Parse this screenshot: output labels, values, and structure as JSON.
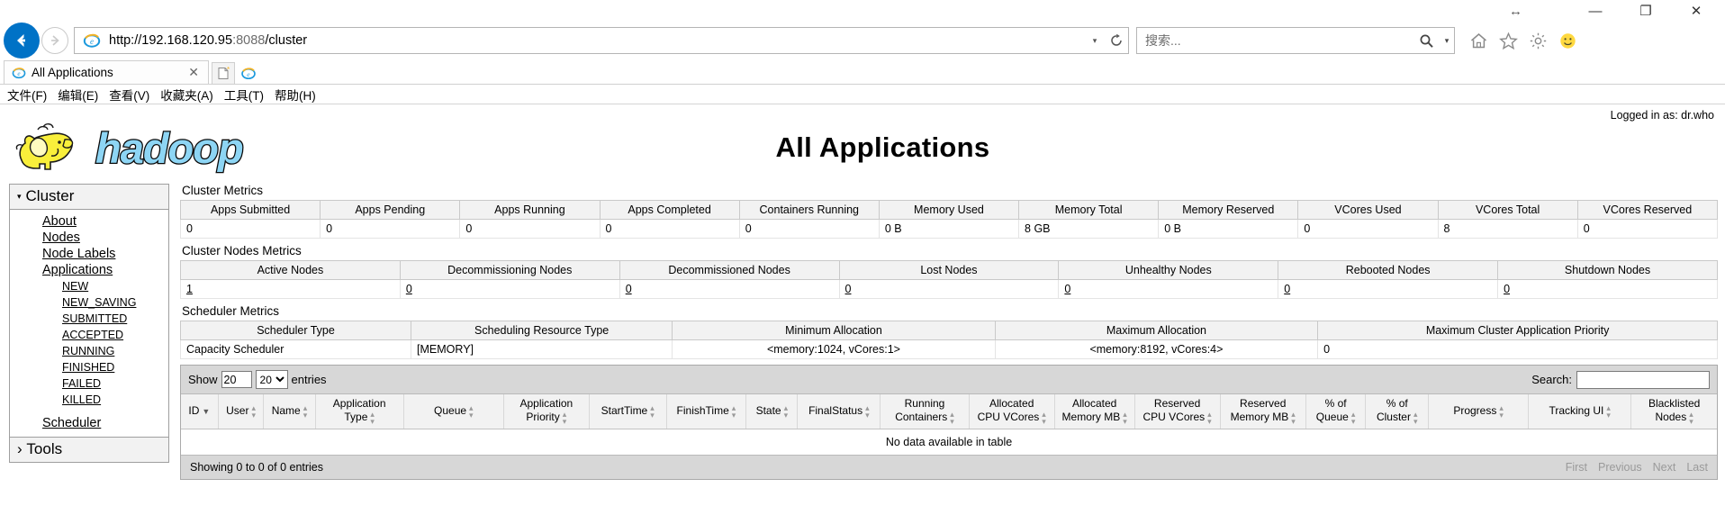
{
  "browser": {
    "window_controls": {
      "minimize": "—",
      "restore": "❐",
      "close": "✕",
      "restore_hint": "↔"
    },
    "nav": {
      "back": "back-arrow",
      "forward": "forward-arrow"
    },
    "address": {
      "url_scheme": "http://192.168.120.95",
      "url_port": ":8088",
      "url_path": "/cluster",
      "dropdown": "▾",
      "refresh": "refresh-icon"
    },
    "search": {
      "placeholder": "搜索...",
      "caret": "▾"
    },
    "toolbar_icons": [
      "home-icon",
      "favorites-star-icon",
      "tools-gear-icon",
      "smiley-feedback-icon"
    ],
    "tab": {
      "label": "All Applications",
      "close": "✕"
    },
    "menubar": [
      "文件(F)",
      "编辑(E)",
      "查看(V)",
      "收藏夹(A)",
      "工具(T)",
      "帮助(H)"
    ]
  },
  "page": {
    "title": "All Applications",
    "logged_in": "Logged in as: dr.who",
    "logo_alt": "hadoop"
  },
  "sidebar": {
    "cluster_header": "Cluster",
    "cluster_caret": "▾",
    "items": [
      {
        "label": "About",
        "sub": false
      },
      {
        "label": "Nodes",
        "sub": false
      },
      {
        "label": "Node Labels",
        "sub": false
      },
      {
        "label": "Applications",
        "sub": false
      },
      {
        "label": "NEW",
        "sub": true
      },
      {
        "label": "NEW_SAVING",
        "sub": true
      },
      {
        "label": "SUBMITTED",
        "sub": true
      },
      {
        "label": "ACCEPTED",
        "sub": true
      },
      {
        "label": "RUNNING",
        "sub": true
      },
      {
        "label": "FINISHED",
        "sub": true
      },
      {
        "label": "FAILED",
        "sub": true
      },
      {
        "label": "KILLED",
        "sub": true
      },
      {
        "label": "Scheduler",
        "sub": false
      }
    ],
    "tools_header": "Tools",
    "tools_caret": "›"
  },
  "cluster_metrics": {
    "label": "Cluster Metrics",
    "headers": [
      "Apps Submitted",
      "Apps Pending",
      "Apps Running",
      "Apps Completed",
      "Containers Running",
      "Memory Used",
      "Memory Total",
      "Memory Reserved",
      "VCores Used",
      "VCores Total",
      "VCores Reserved"
    ],
    "values": [
      "0",
      "0",
      "0",
      "0",
      "0",
      "0 B",
      "8 GB",
      "0 B",
      "0",
      "8",
      "0"
    ]
  },
  "cluster_nodes_metrics": {
    "label": "Cluster Nodes Metrics",
    "headers": [
      "Active Nodes",
      "Decommissioning Nodes",
      "Decommissioned Nodes",
      "Lost Nodes",
      "Unhealthy Nodes",
      "Rebooted Nodes",
      "Shutdown Nodes"
    ],
    "values": [
      "1",
      "0",
      "0",
      "0",
      "0",
      "0",
      "0"
    ]
  },
  "scheduler_metrics": {
    "label": "Scheduler Metrics",
    "headers": [
      "Scheduler Type",
      "Scheduling Resource Type",
      "Minimum Allocation",
      "Maximum Allocation",
      "Maximum Cluster Application Priority"
    ],
    "values": [
      "Capacity Scheduler",
      "[MEMORY]",
      "<memory:1024, vCores:1>",
      "<memory:8192, vCores:4>",
      "0"
    ]
  },
  "apps_table": {
    "show_label": "Show",
    "entries_label": "entries",
    "page_length": "20",
    "search_label": "Search:",
    "search_value": "",
    "headers": [
      {
        "line1": "ID",
        "line2": "",
        "sort": "desc"
      },
      {
        "line1": "User",
        "line2": "",
        "sort": "both"
      },
      {
        "line1": "Name",
        "line2": "",
        "sort": "both"
      },
      {
        "line1": "Application",
        "line2": "Type",
        "sort": "both"
      },
      {
        "line1": "Queue",
        "line2": "",
        "sort": "both"
      },
      {
        "line1": "Application",
        "line2": "Priority",
        "sort": "both"
      },
      {
        "line1": "StartTime",
        "line2": "",
        "sort": "both"
      },
      {
        "line1": "FinishTime",
        "line2": "",
        "sort": "both"
      },
      {
        "line1": "State",
        "line2": "",
        "sort": "both"
      },
      {
        "line1": "FinalStatus",
        "line2": "",
        "sort": "both"
      },
      {
        "line1": "Running",
        "line2": "Containers",
        "sort": "both"
      },
      {
        "line1": "Allocated",
        "line2": "CPU VCores",
        "sort": "both"
      },
      {
        "line1": "Allocated",
        "line2": "Memory MB",
        "sort": "both"
      },
      {
        "line1": "Reserved",
        "line2": "CPU VCores",
        "sort": "both"
      },
      {
        "line1": "Reserved",
        "line2": "Memory MB",
        "sort": "both"
      },
      {
        "line1": "% of",
        "line2": "Queue",
        "sort": "both"
      },
      {
        "line1": "% of",
        "line2": "Cluster",
        "sort": "both"
      },
      {
        "line1": "Progress",
        "line2": "",
        "sort": "both"
      },
      {
        "line1": "Tracking UI",
        "line2": "",
        "sort": "both"
      },
      {
        "line1": "Blacklisted",
        "line2": "Nodes",
        "sort": "both"
      }
    ],
    "no_data": "No data available in table",
    "info": "Showing 0 to 0 of 0 entries",
    "pager": [
      "First",
      "Previous",
      "Next",
      "Last"
    ]
  },
  "colors": {
    "ie_blue": "#0072C6",
    "hadoop_blue": "#8DD5F4",
    "hadoop_yellow": "#F9EF3B",
    "toolbar_gray": "#d7d7d7",
    "header_gray": "#f2f2f2"
  }
}
